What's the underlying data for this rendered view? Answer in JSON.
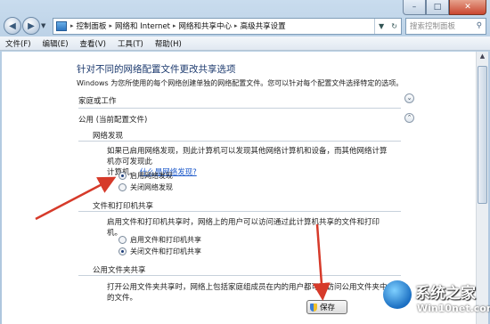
{
  "window": {
    "minimize": "–",
    "maximize": "□",
    "close": "✕"
  },
  "address": {
    "crumbs": [
      "控制面板",
      "网络和 Internet",
      "网络和共享中心",
      "高级共享设置"
    ],
    "search_placeholder": "搜索控制面板"
  },
  "menu": [
    "文件(F)",
    "编辑(E)",
    "查看(V)",
    "工具(T)",
    "帮助(H)"
  ],
  "page": {
    "title": "针对不同的网络配置文件更改共享选项",
    "description": "Windows 为您所使用的每个网络创建单独的网络配置文件。您可以针对每个配置文件选择特定的选项。",
    "profile_home_work": "家庭或工作",
    "profile_public": "公用 (当前配置文件)",
    "discovery": {
      "heading": "网络发现",
      "text_line1": "如果已启用网络发现，则此计算机可以发现其他网络计算机和设备，而其他网络计算机亦可发现此",
      "text_line2": "计算机。",
      "link": "什么是网络发现?",
      "option_on": "启用网络发现",
      "option_off": "关闭网络发现",
      "selected": "启用网络发现"
    },
    "file_sharing": {
      "heading": "文件和打印机共享",
      "text": "启用文件和打印机共享时，网络上的用户可以访问通过此计算机共享的文件和打印机。",
      "option_on": "启用文件和打印机共享",
      "option_off": "关闭文件和打印机共享",
      "selected": "关闭文件和打印机共享"
    },
    "public_folder": {
      "heading": "公用文件夹共享",
      "text": "打开公用文件夹共享时，网络上包括家庭组成员在内的用户都可以访问公用文件夹中的文件。"
    },
    "save_label": "保存"
  },
  "watermark": {
    "text": "系统之家",
    "url": "Win10net.com"
  },
  "colors": {
    "annotation_arrow": "#d63a2a",
    "title": "#1c3a6e",
    "link": "#1a57c9"
  }
}
